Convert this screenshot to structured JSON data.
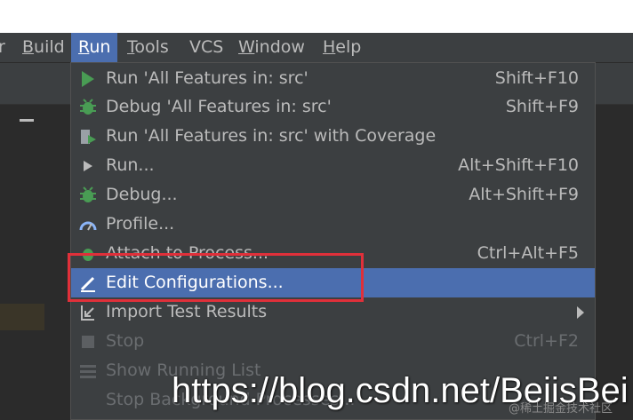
{
  "menubar": {
    "items": [
      {
        "label": "Build",
        "underline": "B",
        "rest": "uild"
      },
      {
        "label": "Run",
        "underline": "R",
        "rest": "un"
      },
      {
        "label": "Tools",
        "underline": "T",
        "rest": "ools"
      },
      {
        "label": "VCS",
        "underline": "",
        "rest": "VCS"
      },
      {
        "label": "Window",
        "underline": "W",
        "rest": "indow"
      },
      {
        "label": "Help",
        "underline": "H",
        "rest": "elp"
      }
    ]
  },
  "run_menu": {
    "items": [
      {
        "label": "Run 'All Features in: src'",
        "shortcut": "Shift+F10",
        "icon": "run-icon",
        "state": "enabled"
      },
      {
        "label": "Debug 'All Features in: src'",
        "shortcut": "Shift+F9",
        "icon": "debug-icon",
        "state": "enabled"
      },
      {
        "label": "Run 'All Features in: src' with Coverage",
        "shortcut": "",
        "icon": "coverage-icon",
        "state": "enabled"
      },
      {
        "label": "Run...",
        "shortcut": "Alt+Shift+F10",
        "icon": "run-small-icon",
        "state": "enabled"
      },
      {
        "label": "Debug...",
        "shortcut": "Alt+Shift+F9",
        "icon": "debug-icon",
        "state": "enabled"
      },
      {
        "label": "Profile...",
        "shortcut": "",
        "icon": "profile-icon",
        "state": "enabled"
      },
      {
        "label": "Attach to Process...",
        "shortcut": "Ctrl+Alt+F5",
        "icon": "attach-icon",
        "state": "enabled"
      },
      {
        "label": "Edit Configurations...",
        "shortcut": "",
        "icon": "edit-icon",
        "state": "selected"
      },
      {
        "label": "Import Test Results",
        "shortcut": "",
        "icon": "import-icon",
        "state": "submenu"
      },
      {
        "label": "Stop",
        "shortcut": "Ctrl+F2",
        "icon": "stop-icon",
        "state": "disabled"
      },
      {
        "label": "Show Running List",
        "shortcut": "",
        "icon": "list-icon",
        "state": "disabled"
      },
      {
        "label": "Stop Background Processes...",
        "shortcut": "",
        "icon": "",
        "state": "disabled"
      }
    ]
  },
  "watermark": {
    "url": "https://blog.csdn.net/BeiisBei",
    "sub": "@稀土掘金技术社区"
  },
  "colors": {
    "menubar_bg": "#3c3f41",
    "selection": "#4b6eaf",
    "highlight_box": "#e0303a",
    "run_green": "#499c54"
  }
}
